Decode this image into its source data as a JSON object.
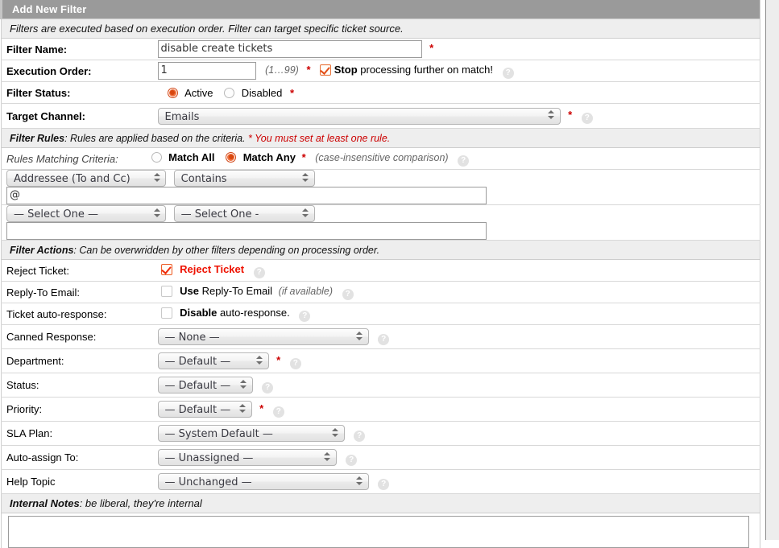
{
  "window": {
    "title": "Add New Filter"
  },
  "colors": {
    "titlebar_bg": "#9a9a9a",
    "section_bg": "#eeeeee",
    "accent_orange": "#e24d16",
    "required_red": "#cc0000",
    "reject_red": "#ee1100"
  },
  "intro_note": {
    "text": "Filters are executed based on execution order. Filter can target specific ticket source."
  },
  "basic": {
    "filter_name": {
      "label": "Filter Name:",
      "value": "disable create tickets",
      "placeholder": "",
      "required_mark": "*"
    },
    "execution_order": {
      "label": "Execution Order:",
      "value": "1",
      "hint": "(1…99)",
      "required_mark": "*",
      "stop_checkbox": {
        "checked": true,
        "label_bold": "Stop",
        "label_rest": "processing further on match!"
      },
      "help_icon": "?"
    },
    "filter_status": {
      "label": "Filter Status:",
      "options": [
        {
          "label": "Active",
          "selected": true
        },
        {
          "label": "Disabled",
          "selected": false
        }
      ],
      "required_mark": "*"
    },
    "target_channel": {
      "label": "Target Channel:",
      "value": "Emails",
      "required_mark": "*",
      "help_icon": "?"
    }
  },
  "rules_section": {
    "title": "Filter Rules",
    "description": ": Rules are applied based on the criteria. ",
    "warning": "* You must set at least one rule.",
    "matching": {
      "label": "Rules Matching Criteria:",
      "options": [
        {
          "label": "Match All",
          "selected": false
        },
        {
          "label": "Match Any",
          "selected": true
        }
      ],
      "required_mark": "*",
      "hint": "(case-insensitive comparison)",
      "help_icon": "?"
    },
    "rows": [
      {
        "what": "Addressee (To and Cc)",
        "how": "Contains",
        "value": ""
      },
      {
        "what": "— Select One —",
        "how": "— Select One -",
        "value": ""
      }
    ],
    "row1_value": "@",
    "row2_value": ""
  },
  "actions_section": {
    "title": "Filter Actions",
    "description": ": Can be overwridden by other filters depending on processing order.",
    "reject_ticket": {
      "label": "Reject Ticket:",
      "checked": true,
      "checkbox_label": "Reject Ticket",
      "help_icon": "?"
    },
    "reply_to_email": {
      "label": "Reply-To Email:",
      "checked": false,
      "label_bold": "Use",
      "label_rest": "Reply-To Email",
      "label_hint": "(if available)",
      "help_icon": "?"
    },
    "auto_response": {
      "label": "Ticket auto-response:",
      "checked": false,
      "label_bold": "Disable",
      "label_rest": "auto-response.",
      "help_icon": "?"
    },
    "canned_response": {
      "label": "Canned Response:",
      "value": "— None —",
      "help_icon": "?"
    },
    "department": {
      "label": "Department:",
      "value": "— Default —",
      "required_mark": "*",
      "help_icon": "?"
    },
    "status": {
      "label": "Status:",
      "value": "— Default —",
      "help_icon": "?"
    },
    "priority": {
      "label": "Priority:",
      "value": "— Default —",
      "required_mark": "*",
      "help_icon": "?"
    },
    "sla_plan": {
      "label": "SLA Plan:",
      "value": "— System Default —",
      "help_icon": "?"
    },
    "auto_assign": {
      "label": "Auto-assign To:",
      "value": "— Unassigned —",
      "help_icon": "?"
    },
    "help_topic": {
      "label": "Help Topic",
      "value": "— Unchanged —",
      "help_icon": "?"
    }
  },
  "notes_section": {
    "title": "Internal Notes",
    "description": ": be liberal, they're internal",
    "value": ""
  }
}
